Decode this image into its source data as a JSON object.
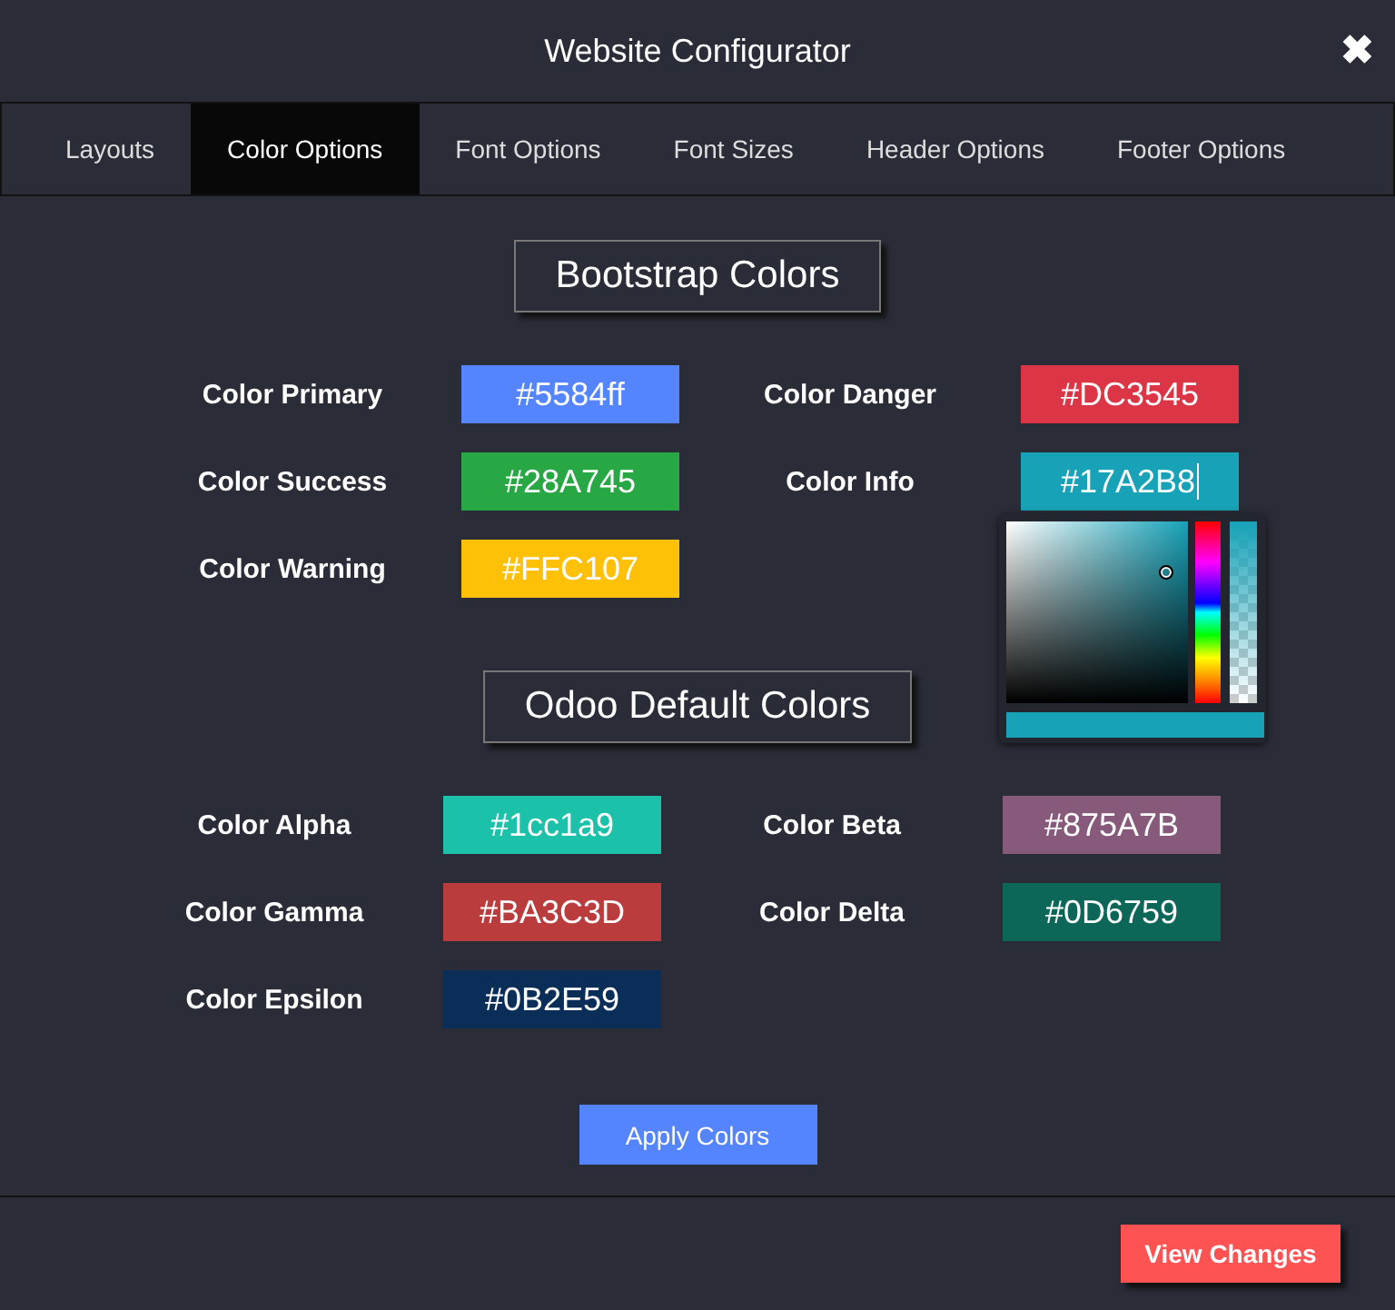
{
  "window": {
    "title": "Website Configurator",
    "close": "✖"
  },
  "tabs": [
    {
      "label": "Layouts",
      "selected": false
    },
    {
      "label": "Color Options",
      "selected": true
    },
    {
      "label": "Font Options",
      "selected": false
    },
    {
      "label": "Font Sizes",
      "selected": false
    },
    {
      "label": "Header Options",
      "selected": false
    },
    {
      "label": "Footer Options",
      "selected": false
    }
  ],
  "sections": [
    {
      "heading": "Bootstrap Colors",
      "fields": [
        {
          "label": "Color Primary",
          "value": "#5584ff",
          "color": "#5584ff",
          "picker_open": false
        },
        {
          "label": "Color Danger",
          "value": "#DC3545",
          "color": "#dc3545",
          "picker_open": false
        },
        {
          "label": "Color Success",
          "value": "#28A745",
          "color": "#28a745",
          "picker_open": false
        },
        {
          "label": "Color Info",
          "value": "#17A2B8",
          "color": "#17a2b8",
          "picker_open": true
        },
        {
          "label": "Color Warning",
          "value": "#FFC107",
          "color": "#ffc107",
          "picker_open": false
        }
      ]
    },
    {
      "heading": "Odoo Default Colors",
      "fields": [
        {
          "label": "Color Alpha",
          "value": "#1cc1a9",
          "color": "#1cc1a9",
          "picker_open": false
        },
        {
          "label": "Color Beta",
          "value": "#875A7B",
          "color": "#875a7b",
          "picker_open": false
        },
        {
          "label": "Color Gamma",
          "value": "#BA3C3D",
          "color": "#ba3c3d",
          "picker_open": false
        },
        {
          "label": "Color Delta",
          "value": "#0D6759",
          "color": "#0d6759",
          "picker_open": false
        },
        {
          "label": "Color Epsilon",
          "value": "#0B2E59",
          "color": "#0b2e59",
          "picker_open": false
        }
      ]
    }
  ],
  "apply_button": "Apply Colors",
  "footer_button": "View Changes"
}
